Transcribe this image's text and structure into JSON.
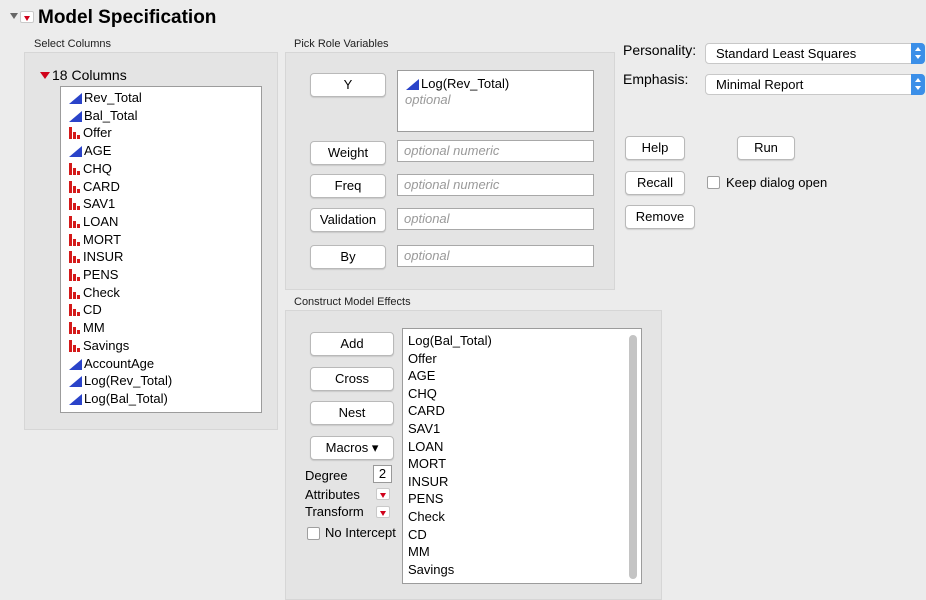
{
  "window": {
    "title": "Model Specification"
  },
  "select_columns": {
    "section_label": "Select Columns",
    "header": "18 Columns",
    "columns": [
      {
        "name": "Rev_Total",
        "type": "continuous"
      },
      {
        "name": "Bal_Total",
        "type": "continuous"
      },
      {
        "name": "Offer",
        "type": "nominal"
      },
      {
        "name": "AGE",
        "type": "continuous"
      },
      {
        "name": "CHQ",
        "type": "nominal"
      },
      {
        "name": "CARD",
        "type": "nominal"
      },
      {
        "name": "SAV1",
        "type": "nominal"
      },
      {
        "name": "LOAN",
        "type": "nominal"
      },
      {
        "name": "MORT",
        "type": "nominal"
      },
      {
        "name": "INSUR",
        "type": "nominal"
      },
      {
        "name": "PENS",
        "type": "nominal"
      },
      {
        "name": "Check",
        "type": "nominal"
      },
      {
        "name": "CD",
        "type": "nominal"
      },
      {
        "name": "MM",
        "type": "nominal"
      },
      {
        "name": "Savings",
        "type": "nominal"
      },
      {
        "name": "AccountAge",
        "type": "continuous"
      },
      {
        "name": "Log(Rev_Total)",
        "type": "continuous"
      },
      {
        "name": "Log(Bal_Total)",
        "type": "continuous"
      }
    ]
  },
  "pick_role": {
    "section_label": "Pick Role Variables",
    "y_button": "Y",
    "y_value": "Log(Rev_Total)",
    "y_placeholder": "optional",
    "weight_button": "Weight",
    "weight_placeholder": "optional numeric",
    "freq_button": "Freq",
    "freq_placeholder": "optional numeric",
    "validation_button": "Validation",
    "validation_placeholder": "optional",
    "by_button": "By",
    "by_placeholder": "optional"
  },
  "construct": {
    "section_label": "Construct Model Effects",
    "add_button": "Add",
    "cross_button": "Cross",
    "nest_button": "Nest",
    "macros_button": "Macros ▾",
    "degree_label": "Degree",
    "degree_value": "2",
    "attributes_label": "Attributes",
    "transform_label": "Transform",
    "no_intercept_label": "No Intercept",
    "effects": [
      "Log(Bal_Total)",
      "Offer",
      "AGE",
      "CHQ",
      "CARD",
      "SAV1",
      "LOAN",
      "MORT",
      "INSUR",
      "PENS",
      "Check",
      "CD",
      "MM",
      "Savings"
    ]
  },
  "settings": {
    "personality_label": "Personality:",
    "personality_value": "Standard Least Squares",
    "emphasis_label": "Emphasis:",
    "emphasis_value": "Minimal Report",
    "help_button": "Help",
    "run_button": "Run",
    "recall_button": "Recall",
    "keep_open_label": "Keep dialog open",
    "remove_button": "Remove"
  },
  "colors": {
    "continuous": "#2a43c9",
    "nominal": "#d41a1a",
    "menu_red": "#d0021b",
    "select_blue": "#3b8fe8"
  }
}
